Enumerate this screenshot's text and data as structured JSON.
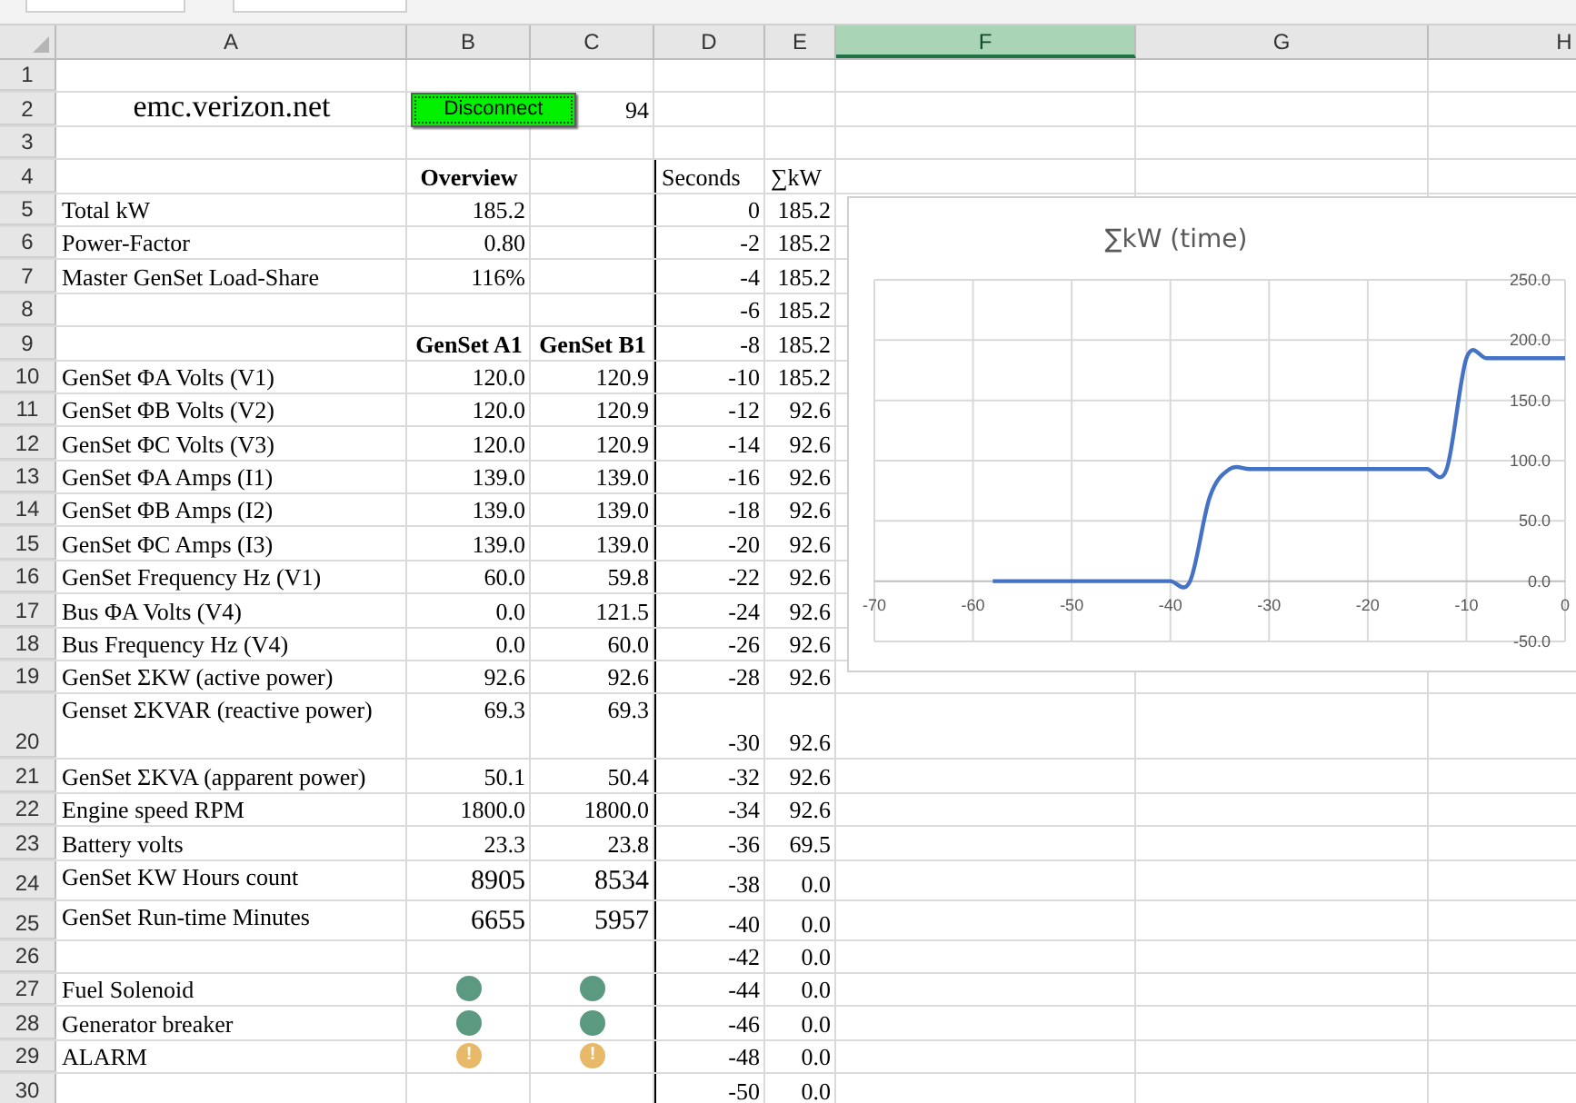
{
  "sheet": {
    "columns": [
      {
        "label": "A",
        "selected": false
      },
      {
        "label": "B",
        "selected": false
      },
      {
        "label": "C",
        "selected": false
      },
      {
        "label": "D",
        "selected": false
      },
      {
        "label": "E",
        "selected": false
      },
      {
        "label": "F",
        "selected": true
      },
      {
        "label": "G",
        "selected": false
      },
      {
        "label": "H",
        "selected": false
      }
    ],
    "rows": [
      {
        "number": "1",
        "cells": {}
      },
      {
        "number": "2",
        "cells": {
          "a": {
            "kind": "title",
            "text": "emc.verizon.net"
          },
          "b": {
            "kind": "button",
            "text": "Disconnect"
          },
          "c": "94"
        }
      },
      {
        "number": "3",
        "cells": {}
      },
      {
        "number": "4",
        "cells": {
          "b": {
            "kind": "text",
            "text": "Overview",
            "bold": true
          },
          "d": {
            "kind": "text",
            "text": "Seconds",
            "bold": false
          },
          "e": {
            "kind": "text",
            "text": "∑kW",
            "bold": false
          }
        }
      },
      {
        "number": "5",
        "cells": {
          "a": "Total kW",
          "b": "185.2",
          "d": "0",
          "e": "185.2"
        }
      },
      {
        "number": "6",
        "cells": {
          "a": "Power-Factor",
          "b": "0.80",
          "d": "-2",
          "e": "185.2"
        }
      },
      {
        "number": "7",
        "cells": {
          "a": "Master GenSet Load-Share",
          "b": "116%",
          "d": "-4",
          "e": "185.2"
        }
      },
      {
        "number": "8",
        "cells": {
          "d": "-6",
          "e": "185.2"
        }
      },
      {
        "number": "9",
        "cells": {
          "b": {
            "kind": "text",
            "text": "GenSet A1",
            "bold": true
          },
          "c": {
            "kind": "text",
            "text": "GenSet B1",
            "bold": true
          },
          "d": "-8",
          "e": "185.2"
        }
      },
      {
        "number": "10",
        "cells": {
          "a": "GenSet ΦA Volts (V1)",
          "b": "120.0",
          "c": "120.9",
          "d": "-10",
          "e": "185.2"
        }
      },
      {
        "number": "11",
        "cells": {
          "a": "GenSet ΦB Volts (V2)",
          "b": "120.0",
          "c": "120.9",
          "d": "-12",
          "e": "92.6"
        }
      },
      {
        "number": "12",
        "cells": {
          "a": "GenSet ΦC Volts (V3)",
          "b": "120.0",
          "c": "120.9",
          "d": "-14",
          "e": "92.6"
        }
      },
      {
        "number": "13",
        "cells": {
          "a": "GenSet ΦA Amps (I1)",
          "b": "139.0",
          "c": "139.0",
          "d": "-16",
          "e": "92.6"
        }
      },
      {
        "number": "14",
        "cells": {
          "a": "GenSet ΦB Amps (I2)",
          "b": "139.0",
          "c": "139.0",
          "d": "-18",
          "e": "92.6"
        }
      },
      {
        "number": "15",
        "cells": {
          "a": "GenSet ΦC Amps (I3)",
          "b": "139.0",
          "c": "139.0",
          "d": "-20",
          "e": "92.6"
        }
      },
      {
        "number": "16",
        "cells": {
          "a": "GenSet Frequency Hz (V1)",
          "b": "60.0",
          "c": "59.8",
          "d": "-22",
          "e": "92.6"
        }
      },
      {
        "number": "17",
        "cells": {
          "a": "Bus ΦA Volts (V4)",
          "b": "0.0",
          "c": "121.5",
          "d": "-24",
          "e": "92.6"
        }
      },
      {
        "number": "18",
        "cells": {
          "a": "Bus Frequency Hz (V4)",
          "b": "0.0",
          "c": "60.0",
          "d": "-26",
          "e": "92.6"
        }
      },
      {
        "number": "19",
        "cells": {
          "a": "GenSet ΣKW (active power)",
          "b": "92.6",
          "c": "92.6",
          "d": "-28",
          "e": "92.6"
        }
      },
      {
        "number": "20",
        "cells": {
          "a": "Genset ΣKVAR (reactive power)",
          "b": "69.3",
          "c": "69.3",
          "d": "-30",
          "e": "92.6"
        }
      },
      {
        "number": "21",
        "cells": {
          "a": "GenSet ΣKVA (apparent power)",
          "b": "50.1",
          "c": "50.4",
          "d": "-32",
          "e": "92.6"
        }
      },
      {
        "number": "22",
        "cells": {
          "a": "Engine speed RPM",
          "b": "1800.0",
          "c": "1800.0",
          "d": "-34",
          "e": "92.6"
        }
      },
      {
        "number": "23",
        "cells": {
          "a": "Battery volts",
          "b": "23.3",
          "c": "23.8",
          "d": "-36",
          "e": "69.5"
        }
      },
      {
        "number": "24",
        "cells": {
          "a": "GenSet KW Hours count",
          "b": "8905",
          "c": "8534",
          "d": "-38",
          "e": "0.0"
        }
      },
      {
        "number": "25",
        "cells": {
          "a": "GenSet Run-time Minutes",
          "b": "6655",
          "c": "5957",
          "d": "-40",
          "e": "0.0"
        }
      },
      {
        "number": "26",
        "cells": {
          "d": "-42",
          "e": "0.0"
        }
      },
      {
        "number": "27",
        "cells": {
          "a": "Fuel Solenoid",
          "b": {
            "kind": "dot",
            "color": "#5b9a80"
          },
          "c": {
            "kind": "dot",
            "color": "#5b9a80"
          },
          "d": "-44",
          "e": "0.0"
        }
      },
      {
        "number": "28",
        "cells": {
          "a": "Generator breaker",
          "b": {
            "kind": "dot",
            "color": "#5b9a80"
          },
          "c": {
            "kind": "dot",
            "color": "#5b9a80"
          },
          "d": "-46",
          "e": "0.0"
        }
      },
      {
        "number": "29",
        "cells": {
          "a": "ALARM",
          "b": {
            "kind": "alarm",
            "color": "#e8b968",
            "text": "!"
          },
          "c": {
            "kind": "alarm",
            "color": "#e8b968",
            "text": "!"
          },
          "d": "-48",
          "e": "0.0"
        }
      },
      {
        "number": "30",
        "cells": {
          "d": "-50",
          "e": "0.0"
        }
      }
    ]
  },
  "chart": {
    "chart_data": {
      "type": "line",
      "title": "∑kW (time)",
      "x": [
        -58,
        -56,
        -54,
        -52,
        -50,
        -48,
        -46,
        -44,
        -42,
        -40,
        -38,
        -36,
        -34,
        -32,
        -30,
        -28,
        -26,
        -24,
        -22,
        -20,
        -18,
        -16,
        -14,
        -12,
        -10,
        -8,
        -6,
        -4,
        -2,
        0
      ],
      "series": [
        {
          "color": "#4472c4",
          "values": [
            0,
            0,
            0,
            0,
            0,
            0,
            0,
            0,
            0,
            0,
            0,
            70,
            93,
            93,
            93,
            93,
            93,
            93,
            93,
            93,
            93,
            93,
            93,
            93,
            185,
            185,
            185,
            185,
            185,
            185
          ]
        }
      ],
      "grid": true,
      "xlim": [
        -70,
        0
      ],
      "ylim": [
        -50,
        250
      ],
      "xticks": [
        -70,
        -60,
        -50,
        -40,
        -30,
        -20,
        -10,
        0
      ],
      "yticks": [
        {
          "value": -50,
          "label": "-50.0"
        },
        {
          "value": 0,
          "label": "0.0"
        },
        {
          "value": 50,
          "label": "50.0"
        },
        {
          "value": 100,
          "label": "100.0"
        },
        {
          "value": 150,
          "label": "150.0"
        },
        {
          "value": 200,
          "label": "200.0"
        },
        {
          "value": 250,
          "label": "250.0"
        }
      ]
    }
  }
}
